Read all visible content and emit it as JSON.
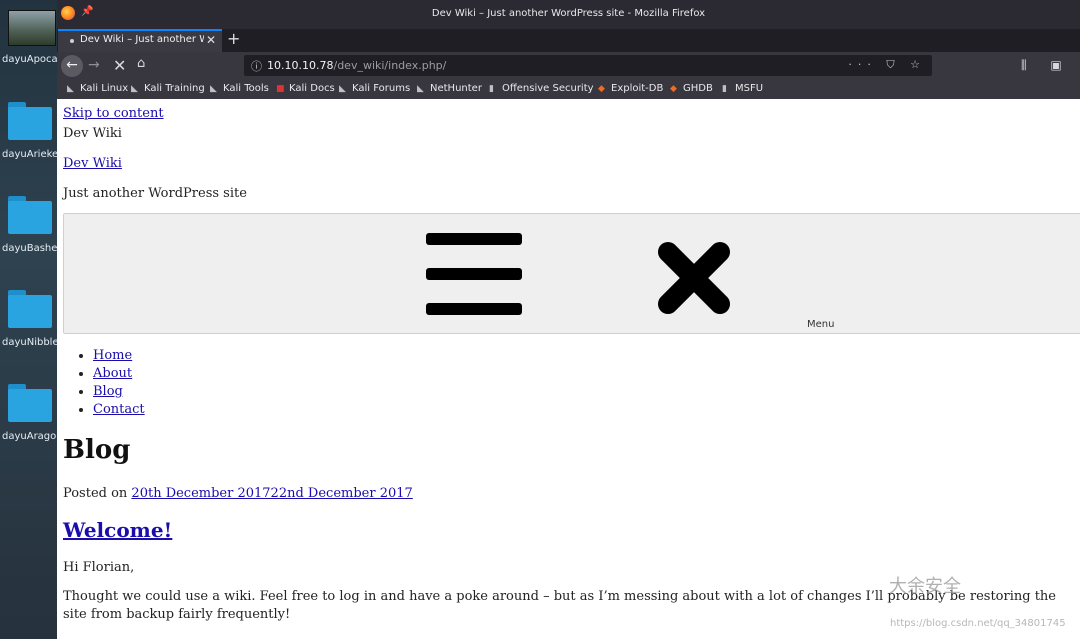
{
  "desktop": {
    "icons": [
      {
        "label": "dayuApocaly"
      },
      {
        "label": "dayuArieke"
      },
      {
        "label": "dayuBashec"
      },
      {
        "label": "dayuNibble"
      },
      {
        "label": "dayuArago"
      }
    ]
  },
  "window": {
    "title": "Dev Wiki – Just another WordPress site - Mozilla Firefox",
    "tab_title": "Dev Wiki – Just another W",
    "tab_close": "✕",
    "new_tab": "+",
    "url_host": "10.10.10.78",
    "url_path": "/dev_wiki/index.php/",
    "url_actions": "··· ⛉ ☆",
    "toolbar_right": "⫼ ▣ ▮"
  },
  "bookmarks": [
    {
      "label": "Kali Linux",
      "icon": "kali-dragon-icon"
    },
    {
      "label": "Kali Training",
      "icon": "kali-dragon-icon"
    },
    {
      "label": "Kali Tools",
      "icon": "kali-dragon-icon"
    },
    {
      "label": "Kali Docs",
      "icon": "kali-docs-icon"
    },
    {
      "label": "Kali Forums",
      "icon": "kali-dragon-icon"
    },
    {
      "label": "NetHunter",
      "icon": "kali-dragon-icon"
    },
    {
      "label": "Offensive Security",
      "icon": "offsec-icon"
    },
    {
      "label": "Exploit-DB",
      "icon": "exploitdb-icon"
    },
    {
      "label": "GHDB",
      "icon": "exploitdb-icon"
    },
    {
      "label": "MSFU",
      "icon": "offsec-icon"
    }
  ],
  "page": {
    "skip_link": "Skip to content",
    "site_title_text": "Dev Wiki",
    "site_title_link": "Dev Wiki",
    "tagline": "Just another WordPress site",
    "menu_label": "Menu",
    "nav": [
      "Home",
      "About",
      "Blog",
      "Contact"
    ],
    "heading": "Blog",
    "posted_on": "Posted on ",
    "post_dates": "20th December 201722nd December 2017",
    "post_title": "Welcome!",
    "greeting": "Hi Florian,",
    "body": "Thought we could use a wiki.  Feel free to log in and have a poke around – but as I’m messing about with a lot of changes I’ll probably be restoring the site from backup fairly frequently!"
  },
  "watermark": {
    "text": "大余安全",
    "url": "https://blog.csdn.net/qq_34801745"
  }
}
